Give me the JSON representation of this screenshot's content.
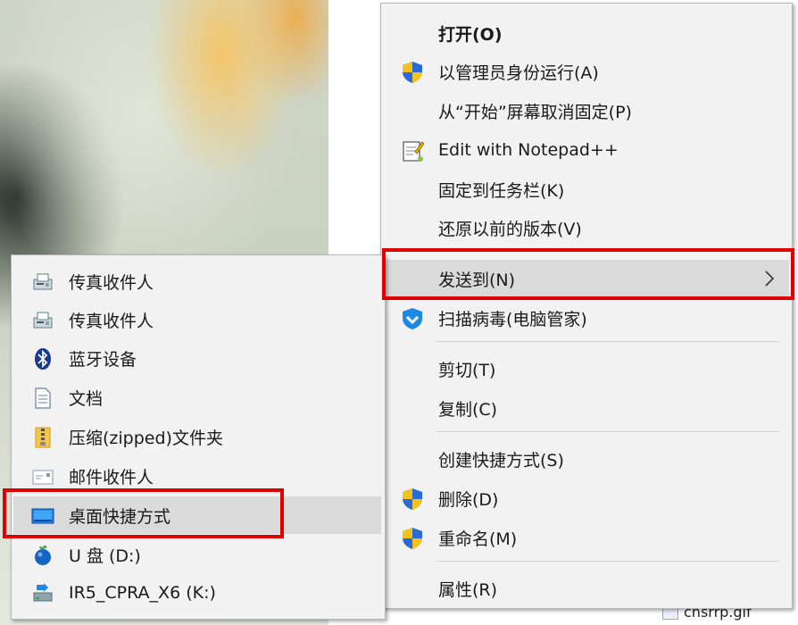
{
  "main_menu": {
    "items": [
      {
        "label": "打开(O)",
        "icon": "none"
      },
      {
        "label": "以管理员身份运行(A)",
        "icon": "uac-shield-icon"
      },
      {
        "label": "从“开始”屏幕取消固定(P)",
        "icon": "none"
      },
      {
        "label": "Edit with Notepad++",
        "icon": "notepad-plus-plus-icon"
      },
      {
        "label": "固定到任务栏(K)",
        "icon": "none"
      },
      {
        "label": "还原以前的版本(V)",
        "icon": "none"
      },
      {
        "label": "发送到(N)",
        "icon": "none"
      },
      {
        "label": "扫描病毒(电脑管家)",
        "icon": "tencent-pc-manager-icon"
      },
      {
        "label": "剪切(T)",
        "icon": "none"
      },
      {
        "label": "复制(C)",
        "icon": "none"
      },
      {
        "label": "创建快捷方式(S)",
        "icon": "none"
      },
      {
        "label": "删除(D)",
        "icon": "uac-shield-icon"
      },
      {
        "label": "重命名(M)",
        "icon": "uac-shield-icon"
      },
      {
        "label": "属性(R)",
        "icon": "none"
      }
    ]
  },
  "send_to_menu": {
    "items": [
      {
        "label": "传真收件人",
        "icon": "fax-icon"
      },
      {
        "label": "传真收件人",
        "icon": "fax-icon"
      },
      {
        "label": "蓝牙设备",
        "icon": "bluetooth-icon"
      },
      {
        "label": "文档",
        "icon": "document-icon"
      },
      {
        "label": "压缩(zipped)文件夹",
        "icon": "zip-folder-icon"
      },
      {
        "label": "邮件收件人",
        "icon": "mail-icon"
      },
      {
        "label": "桌面快捷方式",
        "icon": "desktop-icon"
      },
      {
        "label": "U 盘 (D:)",
        "icon": "usb-drive-icon"
      },
      {
        "label": "IR5_CPRA_X6 (K:)",
        "icon": "network-drive-icon"
      }
    ]
  },
  "background_file": {
    "label": "cnsrrp.gif"
  },
  "colors": {
    "highlight_box": "#e00000",
    "menu_bg": "#f2f2f2",
    "hover_bg": "#dadada"
  }
}
